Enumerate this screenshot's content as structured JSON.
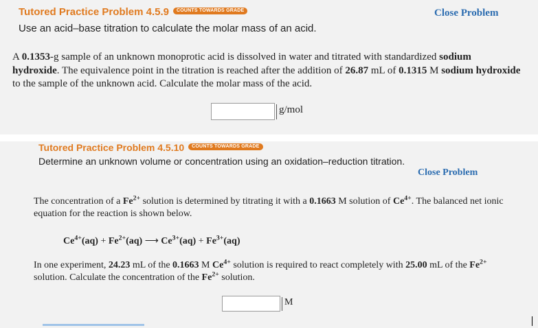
{
  "problem1": {
    "title": "Tutored Practice Problem 4.5.9",
    "badge": "COUNTS TOWARDS GRADE",
    "subtitle": "Use an acid–base titration to calculate the molar mass of an acid.",
    "close_label": "Close Problem",
    "q_a": "A ",
    "q_mass": "0.1353",
    "q_b": "-g sample of an unknown monoprotic acid is dissolved in water and titrated with standardized ",
    "q_naoh1": "sodium hydroxide",
    "q_c": ". The equivalence point in the titration is reached after the addition of ",
    "q_vol": "26.87",
    "q_d": " mL of ",
    "q_conc": "0.1315",
    "q_e": " M ",
    "q_naoh2": "sodium hydroxide",
    "q_f": " to the sample of the unknown acid. Calculate the molar mass of the acid.",
    "answer_value": "",
    "unit": "g/mol"
  },
  "problem2": {
    "title": "Tutored Practice Problem 4.5.10",
    "badge": "COUNTS TOWARDS GRADE",
    "subtitle": "Determine an unknown volume or concentration using an oxidation–reduction titration.",
    "close_label": "Close Problem",
    "p1_a": "The concentration of a ",
    "p1_fe": "Fe",
    "p1_fe_ch": "2+",
    "p1_b": " solution is determined by titrating it with a ",
    "p1_conc": "0.1663",
    "p1_c": " M solution of ",
    "p1_ce": "Ce",
    "p1_ce_ch": "4+",
    "p1_d": ". The balanced net ionic equation for the reaction is shown below.",
    "eq_r1": "Ce",
    "eq_r1_ch": "4+",
    "eq_r1_st": "(aq)",
    "eq_plus1": " + ",
    "eq_r2": "Fe",
    "eq_r2_ch": "2+",
    "eq_r2_st": "(aq)",
    "eq_arrow": "⟶",
    "eq_p1": "Ce",
    "eq_p1_ch": "3+",
    "eq_p1_st": "(aq)",
    "eq_plus2": " + ",
    "eq_p2": "Fe",
    "eq_p2_ch": "3+",
    "eq_p2_st": "(aq)",
    "p2_a": "In one experiment, ",
    "p2_vol": "24.23",
    "p2_b": " mL of the ",
    "p2_conc": "0.1663",
    "p2_c": " M ",
    "p2_ce": "Ce",
    "p2_ce_ch": "4+",
    "p2_d": " solution is required to react completely with ",
    "p2_vol2": "25.00",
    "p2_e": " mL of the ",
    "p2_fe": "Fe",
    "p2_fe_ch": "2+",
    "p2_f": " solution. Calculate the concentration of the ",
    "p2_fe2": "Fe",
    "p2_fe2_ch": "2+",
    "p2_g": " solution.",
    "answer_value": "",
    "unit": "M"
  }
}
